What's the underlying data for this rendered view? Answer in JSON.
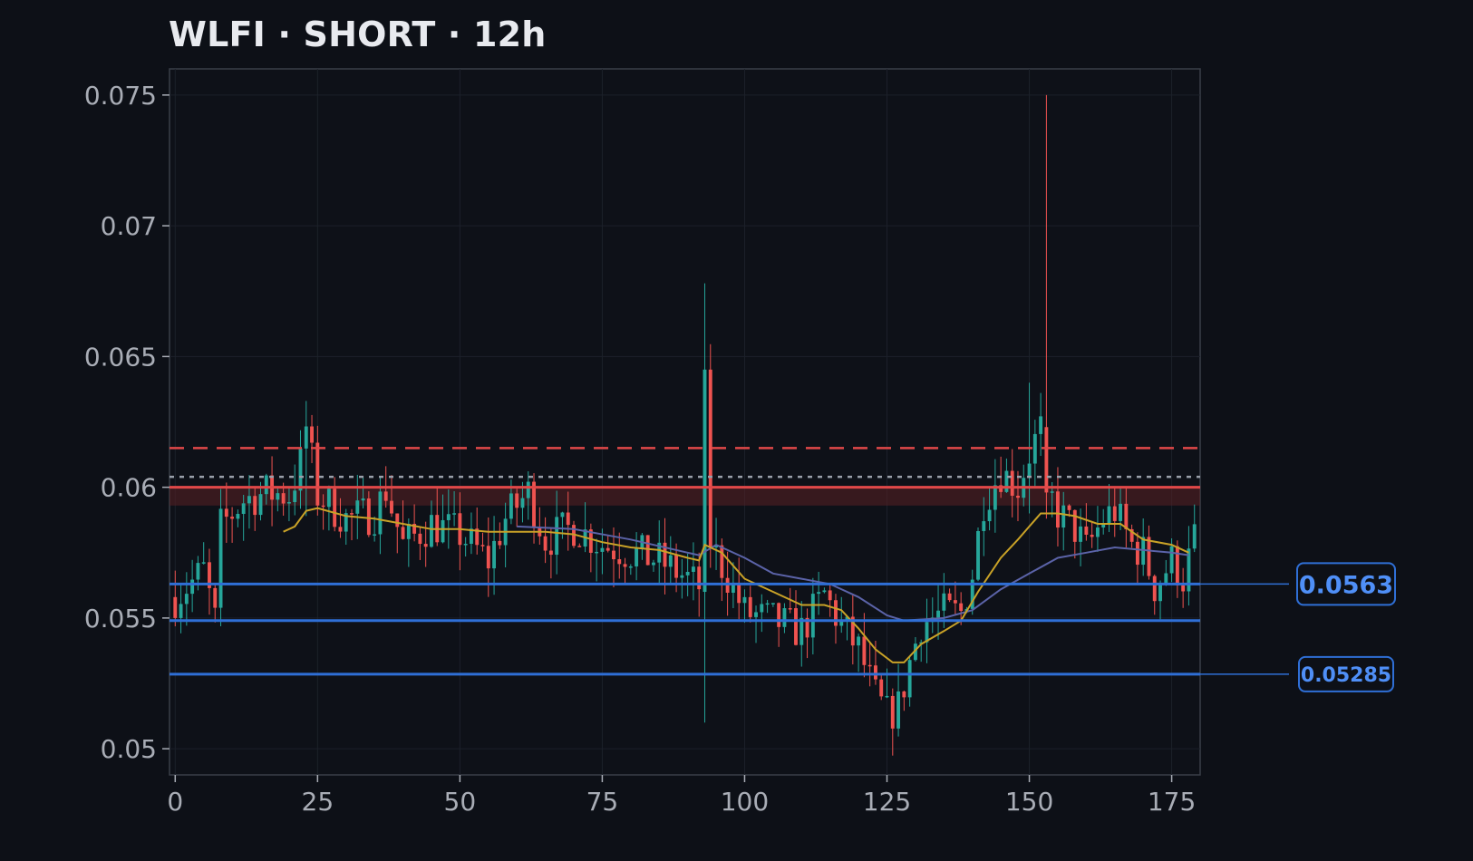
{
  "colors": {
    "background": "#0d1017",
    "plot_background": "#0e1118",
    "grid": "#1c212a",
    "axis": "#3a3f48",
    "tick_text": "#a9adb6",
    "bull": "#26a69a",
    "bear": "#ef5350",
    "ma_fast": "#c9a227",
    "ma_slow": "#5b63a8",
    "level_blue": "#2f6fd6",
    "entry_line": "#e04848",
    "stop_line": "#e04848",
    "zone_fill": "#5a2124",
    "dotted_line": "#9aa0aa",
    "tag_text": "#4f8ff7"
  },
  "chart_data": {
    "type": "candlestick",
    "title": "WLFI · SHORT · 12h",
    "xlim": [
      -1,
      180
    ],
    "ylim": [
      0.049,
      0.076
    ],
    "x_ticks": [
      0,
      25,
      50,
      75,
      100,
      125,
      150,
      175
    ],
    "y_ticks": [
      0.05,
      0.055,
      0.06,
      0.065,
      0.07,
      0.075
    ],
    "y_tick_labels": [
      "0.05",
      "0.055",
      "0.06",
      "0.065",
      "0.07",
      "0.075"
    ],
    "grid": true,
    "levels": [
      {
        "role": "stop",
        "value": 0.0615,
        "style": "dashed"
      },
      {
        "role": "reference",
        "value": 0.0604,
        "style": "dotted"
      },
      {
        "role": "entry",
        "value": 0.06,
        "style": "solid"
      },
      {
        "role": "take-profit-1",
        "value": 0.0563,
        "style": "solid",
        "tag": "0.0563"
      },
      {
        "role": "support",
        "value": 0.0549,
        "style": "solid"
      },
      {
        "role": "take-profit-2",
        "value": 0.05285,
        "style": "solid",
        "tag": "0.05285"
      }
    ],
    "zone": [
      0.0593,
      0.06
    ],
    "candles_close_path": [
      [
        0,
        0.0558
      ],
      [
        5,
        0.0568
      ],
      [
        7,
        0.0549
      ],
      [
        8,
        0.0585
      ],
      [
        12,
        0.0595
      ],
      [
        16,
        0.0598
      ],
      [
        20,
        0.0597
      ],
      [
        22,
        0.0609
      ],
      [
        23,
        0.0623
      ],
      [
        25,
        0.0597
      ],
      [
        30,
        0.0588
      ],
      [
        35,
        0.059
      ],
      [
        37,
        0.0599
      ],
      [
        40,
        0.0578
      ],
      [
        45,
        0.0586
      ],
      [
        50,
        0.0582
      ],
      [
        55,
        0.0572
      ],
      [
        58,
        0.0588
      ],
      [
        62,
        0.0598
      ],
      [
        65,
        0.058
      ],
      [
        70,
        0.0585
      ],
      [
        75,
        0.0578
      ],
      [
        80,
        0.0575
      ],
      [
        85,
        0.0572
      ],
      [
        90,
        0.0565
      ],
      [
        92,
        0.0562
      ],
      [
        93,
        0.0645
      ],
      [
        94,
        0.0578
      ],
      [
        97,
        0.0566
      ],
      [
        100,
        0.0552
      ],
      [
        105,
        0.0549
      ],
      [
        110,
        0.0545
      ],
      [
        114,
        0.0559
      ],
      [
        117,
        0.0547
      ],
      [
        120,
        0.0538
      ],
      [
        123,
        0.052
      ],
      [
        125,
        0.0513
      ],
      [
        127,
        0.0516
      ],
      [
        129,
        0.0533
      ],
      [
        131,
        0.0548
      ],
      [
        135,
        0.0552
      ],
      [
        138,
        0.0552
      ],
      [
        140,
        0.0567
      ],
      [
        142,
        0.0595
      ],
      [
        145,
        0.0606
      ],
      [
        148,
        0.06
      ],
      [
        150,
        0.0613
      ],
      [
        152,
        0.0622
      ],
      [
        153,
        0.06
      ],
      [
        155,
        0.059
      ],
      [
        158,
        0.0584
      ],
      [
        160,
        0.0576
      ],
      [
        163,
        0.0588
      ],
      [
        165,
        0.0591
      ],
      [
        168,
        0.0578
      ],
      [
        170,
        0.0575
      ],
      [
        172,
        0.0562
      ],
      [
        175,
        0.0572
      ],
      [
        177,
        0.0565
      ],
      [
        179,
        0.058
      ]
    ],
    "spikes": [
      {
        "x": 93,
        "high": 0.0678,
        "low": 0.051
      },
      {
        "x": 153,
        "high": 0.075,
        "low": 0.0588
      },
      {
        "x": 23,
        "high": 0.0633,
        "low": 0.0589
      },
      {
        "x": 150,
        "high": 0.064,
        "low": 0.059
      }
    ],
    "ma_fast_path": [
      [
        19,
        0.0583
      ],
      [
        21,
        0.0585
      ],
      [
        23,
        0.0591
      ],
      [
        25,
        0.0592
      ],
      [
        30,
        0.0589
      ],
      [
        35,
        0.0588
      ],
      [
        40,
        0.0586
      ],
      [
        45,
        0.0584
      ],
      [
        50,
        0.0584
      ],
      [
        55,
        0.0583
      ],
      [
        60,
        0.0583
      ],
      [
        65,
        0.0583
      ],
      [
        70,
        0.0582
      ],
      [
        75,
        0.0579
      ],
      [
        80,
        0.0577
      ],
      [
        85,
        0.0576
      ],
      [
        90,
        0.0573
      ],
      [
        92,
        0.0572
      ],
      [
        93,
        0.0578
      ],
      [
        96,
        0.0575
      ],
      [
        100,
        0.0565
      ],
      [
        105,
        0.056
      ],
      [
        110,
        0.0555
      ],
      [
        114,
        0.0555
      ],
      [
        117,
        0.0553
      ],
      [
        120,
        0.0546
      ],
      [
        123,
        0.0538
      ],
      [
        126,
        0.0533
      ],
      [
        128,
        0.0533
      ],
      [
        131,
        0.054
      ],
      [
        135,
        0.0545
      ],
      [
        138,
        0.0549
      ],
      [
        141,
        0.056
      ],
      [
        145,
        0.0573
      ],
      [
        148,
        0.058
      ],
      [
        150,
        0.0585
      ],
      [
        152,
        0.059
      ],
      [
        155,
        0.059
      ],
      [
        158,
        0.0589
      ],
      [
        162,
        0.0586
      ],
      [
        166,
        0.0586
      ],
      [
        170,
        0.058
      ],
      [
        175,
        0.0578
      ],
      [
        178,
        0.0575
      ]
    ],
    "ma_slow_path": [
      [
        60,
        0.0585
      ],
      [
        70,
        0.0584
      ],
      [
        80,
        0.058
      ],
      [
        90,
        0.0575
      ],
      [
        92,
        0.0574
      ],
      [
        95,
        0.0578
      ],
      [
        100,
        0.0573
      ],
      [
        105,
        0.0567
      ],
      [
        110,
        0.0565
      ],
      [
        115,
        0.0563
      ],
      [
        120,
        0.0558
      ],
      [
        125,
        0.0551
      ],
      [
        128,
        0.0549
      ],
      [
        135,
        0.055
      ],
      [
        140,
        0.0553
      ],
      [
        145,
        0.0561
      ],
      [
        150,
        0.0567
      ],
      [
        155,
        0.0573
      ],
      [
        160,
        0.0575
      ],
      [
        165,
        0.0577
      ],
      [
        170,
        0.0576
      ],
      [
        175,
        0.0575
      ],
      [
        178,
        0.0574
      ]
    ]
  }
}
